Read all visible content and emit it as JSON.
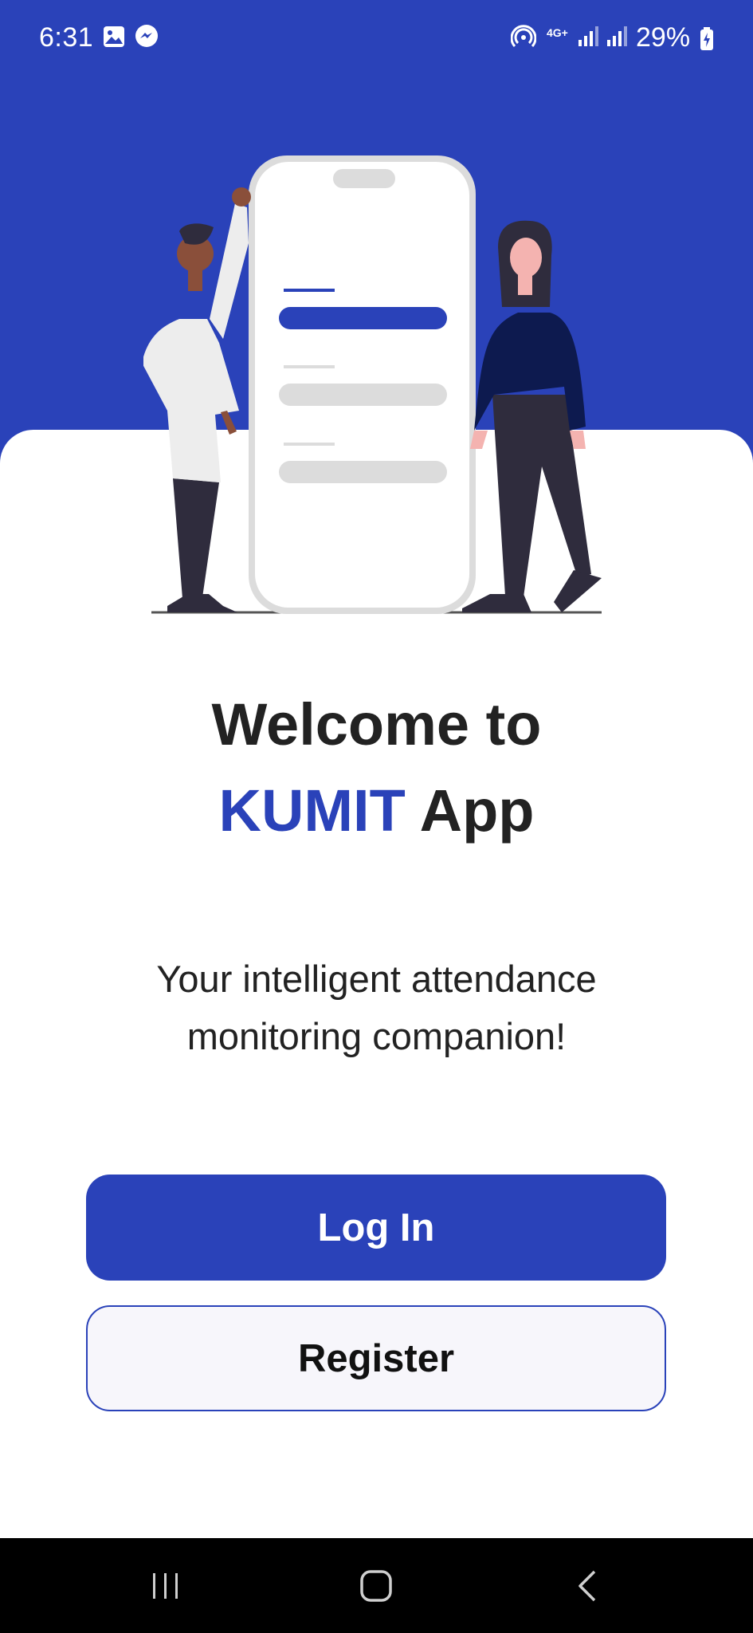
{
  "status_bar": {
    "time": "6:31",
    "network": "4G+",
    "battery": "29%",
    "icons": [
      "gallery-icon",
      "messenger-icon",
      "hotspot-icon",
      "signal-icon",
      "signal-icon",
      "battery-charging-icon"
    ]
  },
  "colors": {
    "brand": "#2a42b9",
    "text": "#222222"
  },
  "illustration": {
    "icon": "two-people-with-phone-illustration"
  },
  "welcome": {
    "line1": "Welcome to",
    "brand": "KUMIT",
    "app": "App"
  },
  "tagline": {
    "line1": "Your intelligent attendance",
    "line2": "monitoring companion!"
  },
  "buttons": {
    "login": "Log In",
    "register": "Register"
  },
  "nav": {
    "icons": [
      "recent-apps-icon",
      "home-icon",
      "back-icon"
    ]
  }
}
